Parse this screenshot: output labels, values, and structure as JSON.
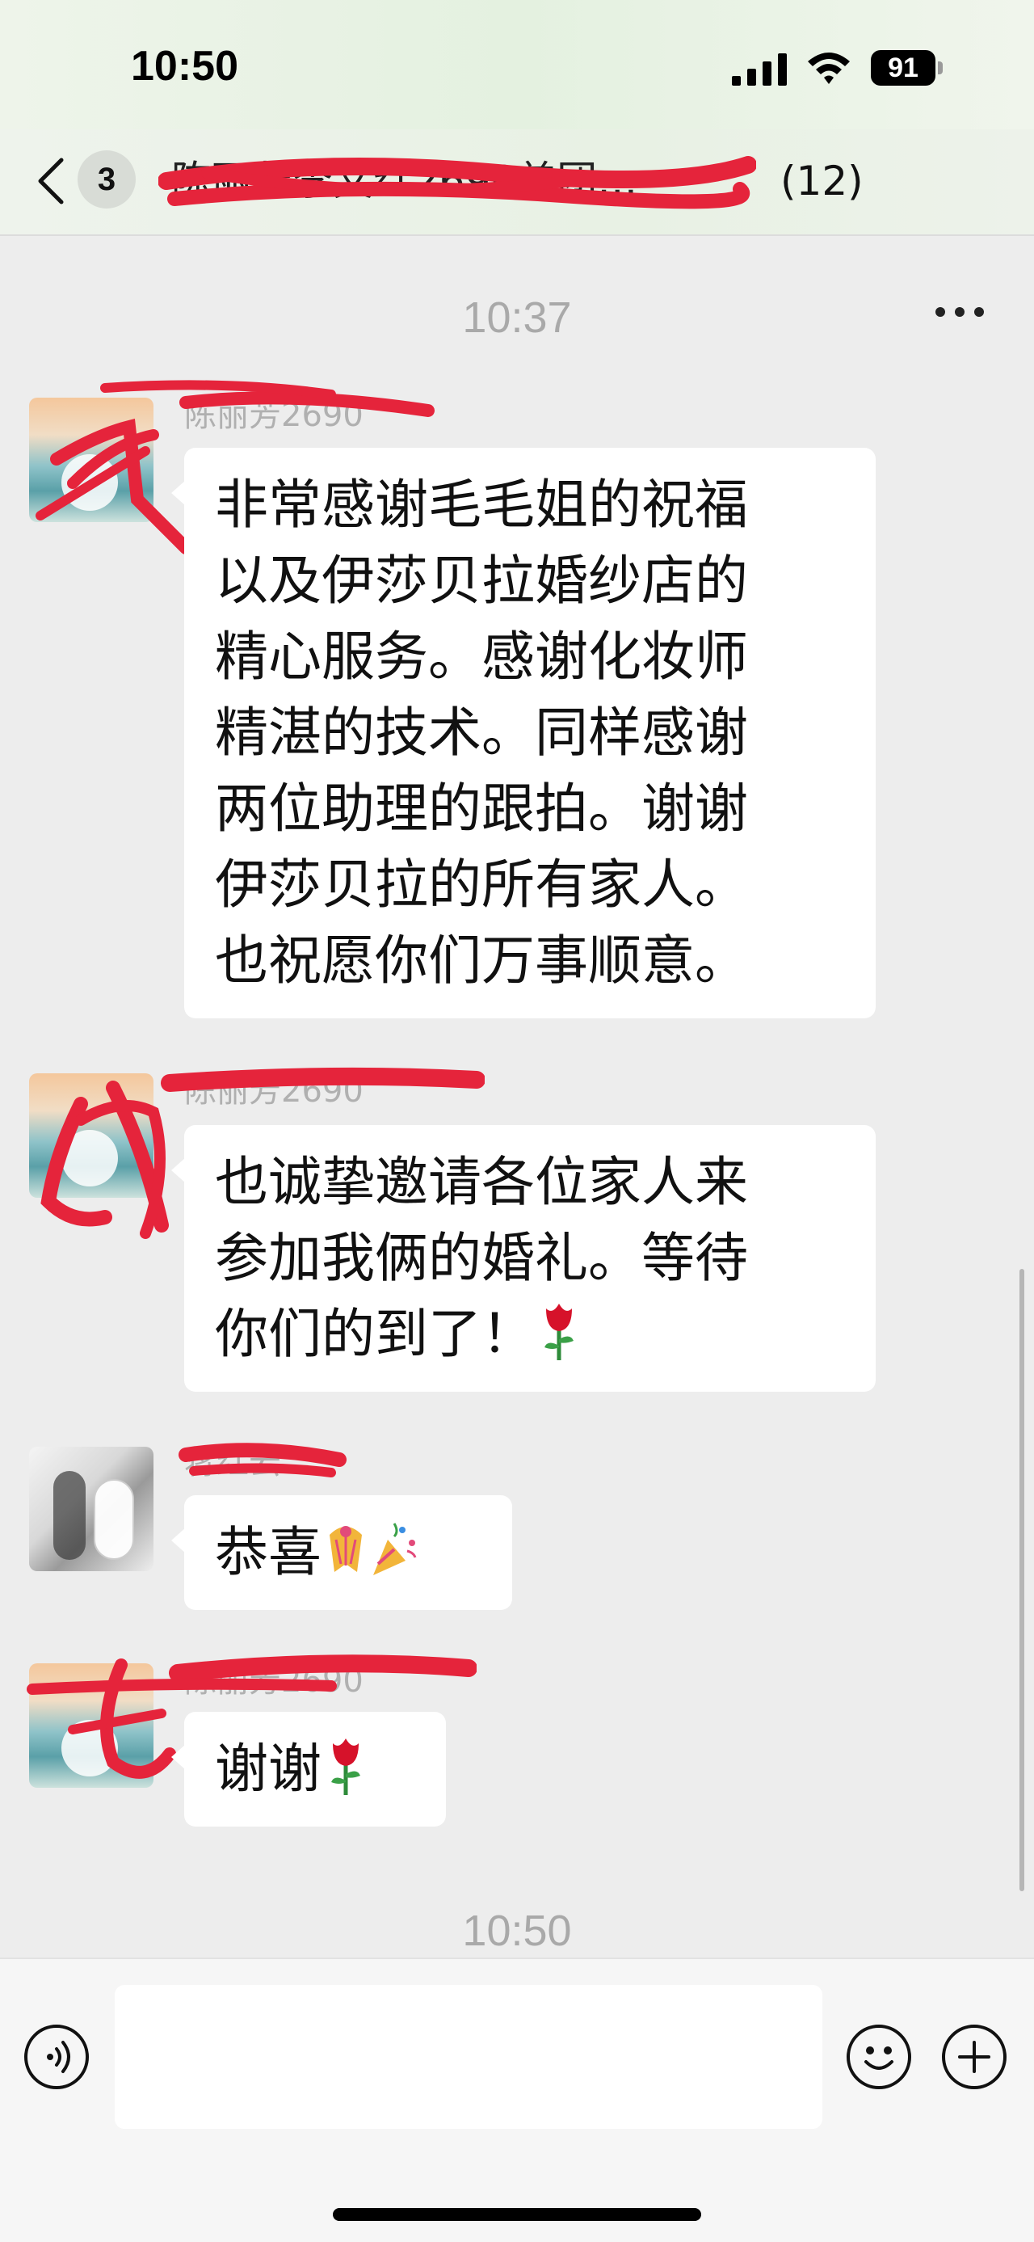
{
  "status_bar": {
    "time": "10:50",
    "battery": "91",
    "icons": [
      "signal-icon",
      "wifi-icon",
      "battery-icon"
    ]
  },
  "nav": {
    "unread_count": "3",
    "title": "陈丽芳李文红2690美团…",
    "member_count": "(12)",
    "icons": [
      "chevron-left-icon",
      "more-icon"
    ]
  },
  "timestamps": {
    "first": "10:37",
    "last": "10:50"
  },
  "messages": [
    {
      "sender": "陈丽芳2690",
      "text": "非常感谢毛毛姐的祝福\n以及伊莎贝拉婚纱店的\n精心服务。感谢化妆师\n精湛的技术。同样感谢\n两位助理的跟拍。谢谢\n伊莎贝拉的所有家人。\n也祝愿你们万事顺意。",
      "emoji": ""
    },
    {
      "sender": "陈丽芳2690",
      "text": "也诚挚邀请各位家人来\n参加我俩的婚礼。等待\n你们的到了！",
      "emoji": "rose"
    },
    {
      "sender": "蒋红云",
      "text": "恭喜",
      "emoji": "celebration"
    },
    {
      "sender": "陈丽芳2690",
      "text": "谢谢",
      "emoji": "rose"
    }
  ],
  "input_bar": {
    "placeholder": "",
    "icons": [
      "voice-icon",
      "emoji-icon",
      "add-icon"
    ]
  },
  "colors": {
    "background": "#ededed",
    "bubble": "#ffffff",
    "redaction": "#e5243b",
    "timestamp": "#a9a9a9"
  }
}
